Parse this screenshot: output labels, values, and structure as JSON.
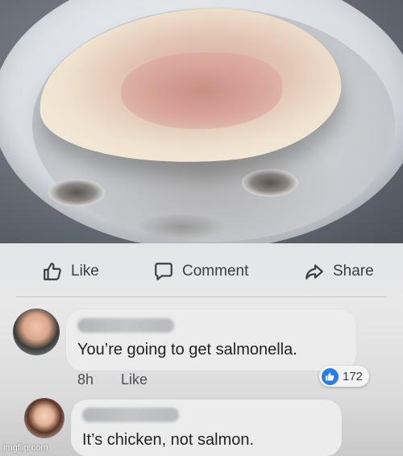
{
  "actions": {
    "like_label": "Like",
    "comment_label": "Comment",
    "share_label": "Share"
  },
  "comments": [
    {
      "text": "You’re going to get salmonella.",
      "time": "8h",
      "like_label": "Like",
      "reaction_count": "172"
    },
    {
      "text": "It’s chicken, not salmon."
    }
  ],
  "watermark": "imgflip.com",
  "colors": {
    "reaction_blue": "#2d7be5",
    "bubble_bg": "#ececed"
  }
}
